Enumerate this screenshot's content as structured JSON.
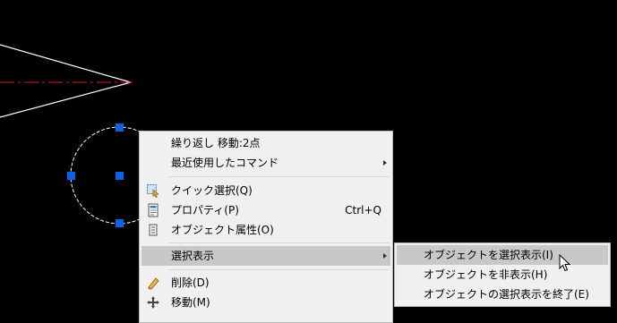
{
  "colors": {
    "background": "#000000",
    "line": "#ffffff",
    "centerline": "#d61e1e",
    "grip": "#0a64e6",
    "menu_bg": "#f0f0f0",
    "highlight": "#c8c8c8"
  },
  "context_menu": {
    "items": [
      {
        "label": "繰り返し 移動:2点"
      },
      {
        "label": "最近使用したコマンド",
        "submenu": true
      },
      {
        "label": "クイック選択(Q)",
        "icon": "quick-select-icon"
      },
      {
        "label": "プロパティ(P)",
        "shortcut": "Ctrl+Q",
        "icon": "properties-icon"
      },
      {
        "label": "オブジェクト属性(O)",
        "icon": "object-attributes-icon"
      },
      {
        "label": "選択表示",
        "submenu": true,
        "highlighted": true
      },
      {
        "label": "削除(D)",
        "icon": "eraser-icon"
      },
      {
        "label": "移動(M)",
        "icon": "move-icon"
      }
    ]
  },
  "submenu": {
    "items": [
      {
        "label": "オブジェクトを選択表示(I)",
        "highlighted": true
      },
      {
        "label": "オブジェクトを非表示(H)"
      },
      {
        "label": "オブジェクトの選択表示を終了(E)"
      }
    ]
  }
}
